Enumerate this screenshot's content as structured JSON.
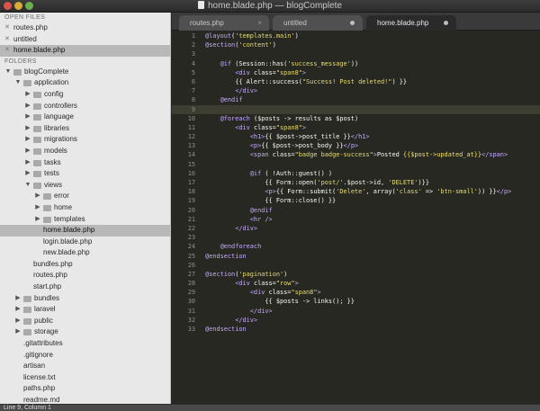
{
  "window": {
    "title": "home.blade.php — blogComplete"
  },
  "sidebar": {
    "open_files_header": "OPEN FILES",
    "open_files": [
      {
        "label": "routes.php",
        "selected": false
      },
      {
        "label": "untitled",
        "selected": false
      },
      {
        "label": "home.blade.php",
        "selected": true
      }
    ],
    "folders_header": "FOLDERS",
    "tree": [
      {
        "label": "blogComplete",
        "level": 0,
        "type": "folder",
        "expanded": true
      },
      {
        "label": "application",
        "level": 1,
        "type": "folder",
        "expanded": true
      },
      {
        "label": "config",
        "level": 2,
        "type": "folder",
        "expanded": false
      },
      {
        "label": "controllers",
        "level": 2,
        "type": "folder",
        "expanded": false
      },
      {
        "label": "language",
        "level": 2,
        "type": "folder",
        "expanded": false
      },
      {
        "label": "libraries",
        "level": 2,
        "type": "folder",
        "expanded": false
      },
      {
        "label": "migrations",
        "level": 2,
        "type": "folder",
        "expanded": false
      },
      {
        "label": "models",
        "level": 2,
        "type": "folder",
        "expanded": false
      },
      {
        "label": "tasks",
        "level": 2,
        "type": "folder",
        "expanded": false
      },
      {
        "label": "tests",
        "level": 2,
        "type": "folder",
        "expanded": false
      },
      {
        "label": "views",
        "level": 2,
        "type": "folder",
        "expanded": true
      },
      {
        "label": "error",
        "level": 3,
        "type": "folder",
        "expanded": false
      },
      {
        "label": "home",
        "level": 3,
        "type": "folder",
        "expanded": false
      },
      {
        "label": "templates",
        "level": 3,
        "type": "folder",
        "expanded": false
      },
      {
        "label": "home.blade.php",
        "level": 3,
        "type": "file",
        "selected": true
      },
      {
        "label": "login.blade.php",
        "level": 3,
        "type": "file"
      },
      {
        "label": "new.blade.php",
        "level": 3,
        "type": "file"
      },
      {
        "label": "bundles.php",
        "level": 2,
        "type": "file"
      },
      {
        "label": "routes.php",
        "level": 2,
        "type": "file"
      },
      {
        "label": "start.php",
        "level": 2,
        "type": "file"
      },
      {
        "label": "bundles",
        "level": 1,
        "type": "folder",
        "expanded": false
      },
      {
        "label": "laravel",
        "level": 1,
        "type": "folder",
        "expanded": false
      },
      {
        "label": "public",
        "level": 1,
        "type": "folder",
        "expanded": false
      },
      {
        "label": "storage",
        "level": 1,
        "type": "folder",
        "expanded": false
      },
      {
        "label": ".gitattributes",
        "level": 1,
        "type": "file"
      },
      {
        "label": ".gitignore",
        "level": 1,
        "type": "file"
      },
      {
        "label": "artisan",
        "level": 1,
        "type": "file"
      },
      {
        "label": "license.txt",
        "level": 1,
        "type": "file"
      },
      {
        "label": "paths.php",
        "level": 1,
        "type": "file"
      },
      {
        "label": "readme.md",
        "level": 1,
        "type": "file"
      }
    ]
  },
  "tabs": [
    {
      "label": "routes.php",
      "active": false,
      "close": "×"
    },
    {
      "label": "untitled",
      "active": false,
      "modified": true
    },
    {
      "label": "home.blade.php",
      "active": true,
      "modified": true
    }
  ],
  "editor": {
    "current_line": 9,
    "lines": [
      [
        [
          "d",
          "@layout"
        ],
        [
          "t",
          "("
        ],
        [
          "s",
          "'templates.main'"
        ],
        [
          "t",
          ")"
        ]
      ],
      [
        [
          "d",
          "@section"
        ],
        [
          "t",
          "("
        ],
        [
          "s",
          "'content'"
        ],
        [
          "t",
          ")"
        ]
      ],
      [],
      [
        [
          "d",
          "    @if"
        ],
        [
          "t",
          " (Session::has("
        ],
        [
          "s",
          "'success_message'"
        ],
        [
          "t",
          "))"
        ]
      ],
      [
        [
          "d",
          "        <div "
        ],
        [
          "t",
          "class="
        ],
        [
          "s",
          "\"span8\""
        ],
        [
          "d",
          ">"
        ]
      ],
      [
        [
          "t",
          "        {{ Alert::success("
        ],
        [
          "s",
          "\"Success! Post deleted!\""
        ],
        [
          "t",
          ") }}"
        ]
      ],
      [
        [
          "d",
          "        </div>"
        ]
      ],
      [
        [
          "d",
          "    @endif"
        ]
      ],
      [],
      [
        [
          "d",
          "    @foreach"
        ],
        [
          "t",
          " ($posts -> results as $post)"
        ]
      ],
      [
        [
          "d",
          "        <div "
        ],
        [
          "t",
          "class="
        ],
        [
          "s",
          "\"span8\""
        ],
        [
          "d",
          ">"
        ]
      ],
      [
        [
          "d",
          "            <h1>"
        ],
        [
          "t",
          "{{ $post->post_title }}"
        ],
        [
          "d",
          "</h1>"
        ]
      ],
      [
        [
          "d",
          "            <p>"
        ],
        [
          "t",
          "{{ $post->post_body }}"
        ],
        [
          "d",
          "</p>"
        ]
      ],
      [
        [
          "d",
          "            <span "
        ],
        [
          "t",
          "class="
        ],
        [
          "s",
          "\"badge badge-success\""
        ],
        [
          "d",
          ">"
        ],
        [
          "t",
          "Posted "
        ],
        [
          "y",
          "{{$post->updated_at}}"
        ],
        [
          "d",
          "</span>"
        ]
      ],
      [],
      [
        [
          "d",
          "            @if"
        ],
        [
          "t",
          " ( !Auth::guest() )"
        ]
      ],
      [
        [
          "t",
          "                {{ Form::open("
        ],
        [
          "s",
          "'post/'"
        ],
        [
          "t",
          ".$post->id, "
        ],
        [
          "s",
          "'DELETE'"
        ],
        [
          "t",
          ")}}"
        ]
      ],
      [
        [
          "d",
          "                <p>"
        ],
        [
          "t",
          "{{ Form::submit("
        ],
        [
          "s",
          "'Delete'"
        ],
        [
          "t",
          ", array("
        ],
        [
          "s",
          "'class'"
        ],
        [
          "t",
          " => "
        ],
        [
          "s",
          "'btn-small'"
        ],
        [
          "t",
          ")) }}"
        ],
        [
          "d",
          "</p>"
        ]
      ],
      [
        [
          "t",
          "                {{ Form::close() }}"
        ]
      ],
      [
        [
          "d",
          "            @endif"
        ]
      ],
      [
        [
          "d",
          "            <hr />"
        ]
      ],
      [
        [
          "d",
          "        </div>"
        ]
      ],
      [],
      [
        [
          "d",
          "    @endforeach"
        ]
      ],
      [
        [
          "d",
          "@endsection"
        ]
      ],
      [],
      [
        [
          "d",
          "@section"
        ],
        [
          "t",
          "("
        ],
        [
          "s",
          "'pagination'"
        ],
        [
          "t",
          ")"
        ]
      ],
      [
        [
          "d",
          "        <div "
        ],
        [
          "t",
          "class="
        ],
        [
          "s",
          "\"row\""
        ],
        [
          "d",
          ">"
        ]
      ],
      [
        [
          "d",
          "            <div "
        ],
        [
          "t",
          "class="
        ],
        [
          "s",
          "\"span8\""
        ],
        [
          "d",
          ">"
        ]
      ],
      [
        [
          "t",
          "                {{ $posts -> links(); }}"
        ]
      ],
      [
        [
          "d",
          "            </div>"
        ]
      ],
      [
        [
          "d",
          "        </div>"
        ]
      ],
      [
        [
          "d",
          "@endsection"
        ]
      ]
    ]
  },
  "status": {
    "text": "Line 9, Column 1"
  }
}
